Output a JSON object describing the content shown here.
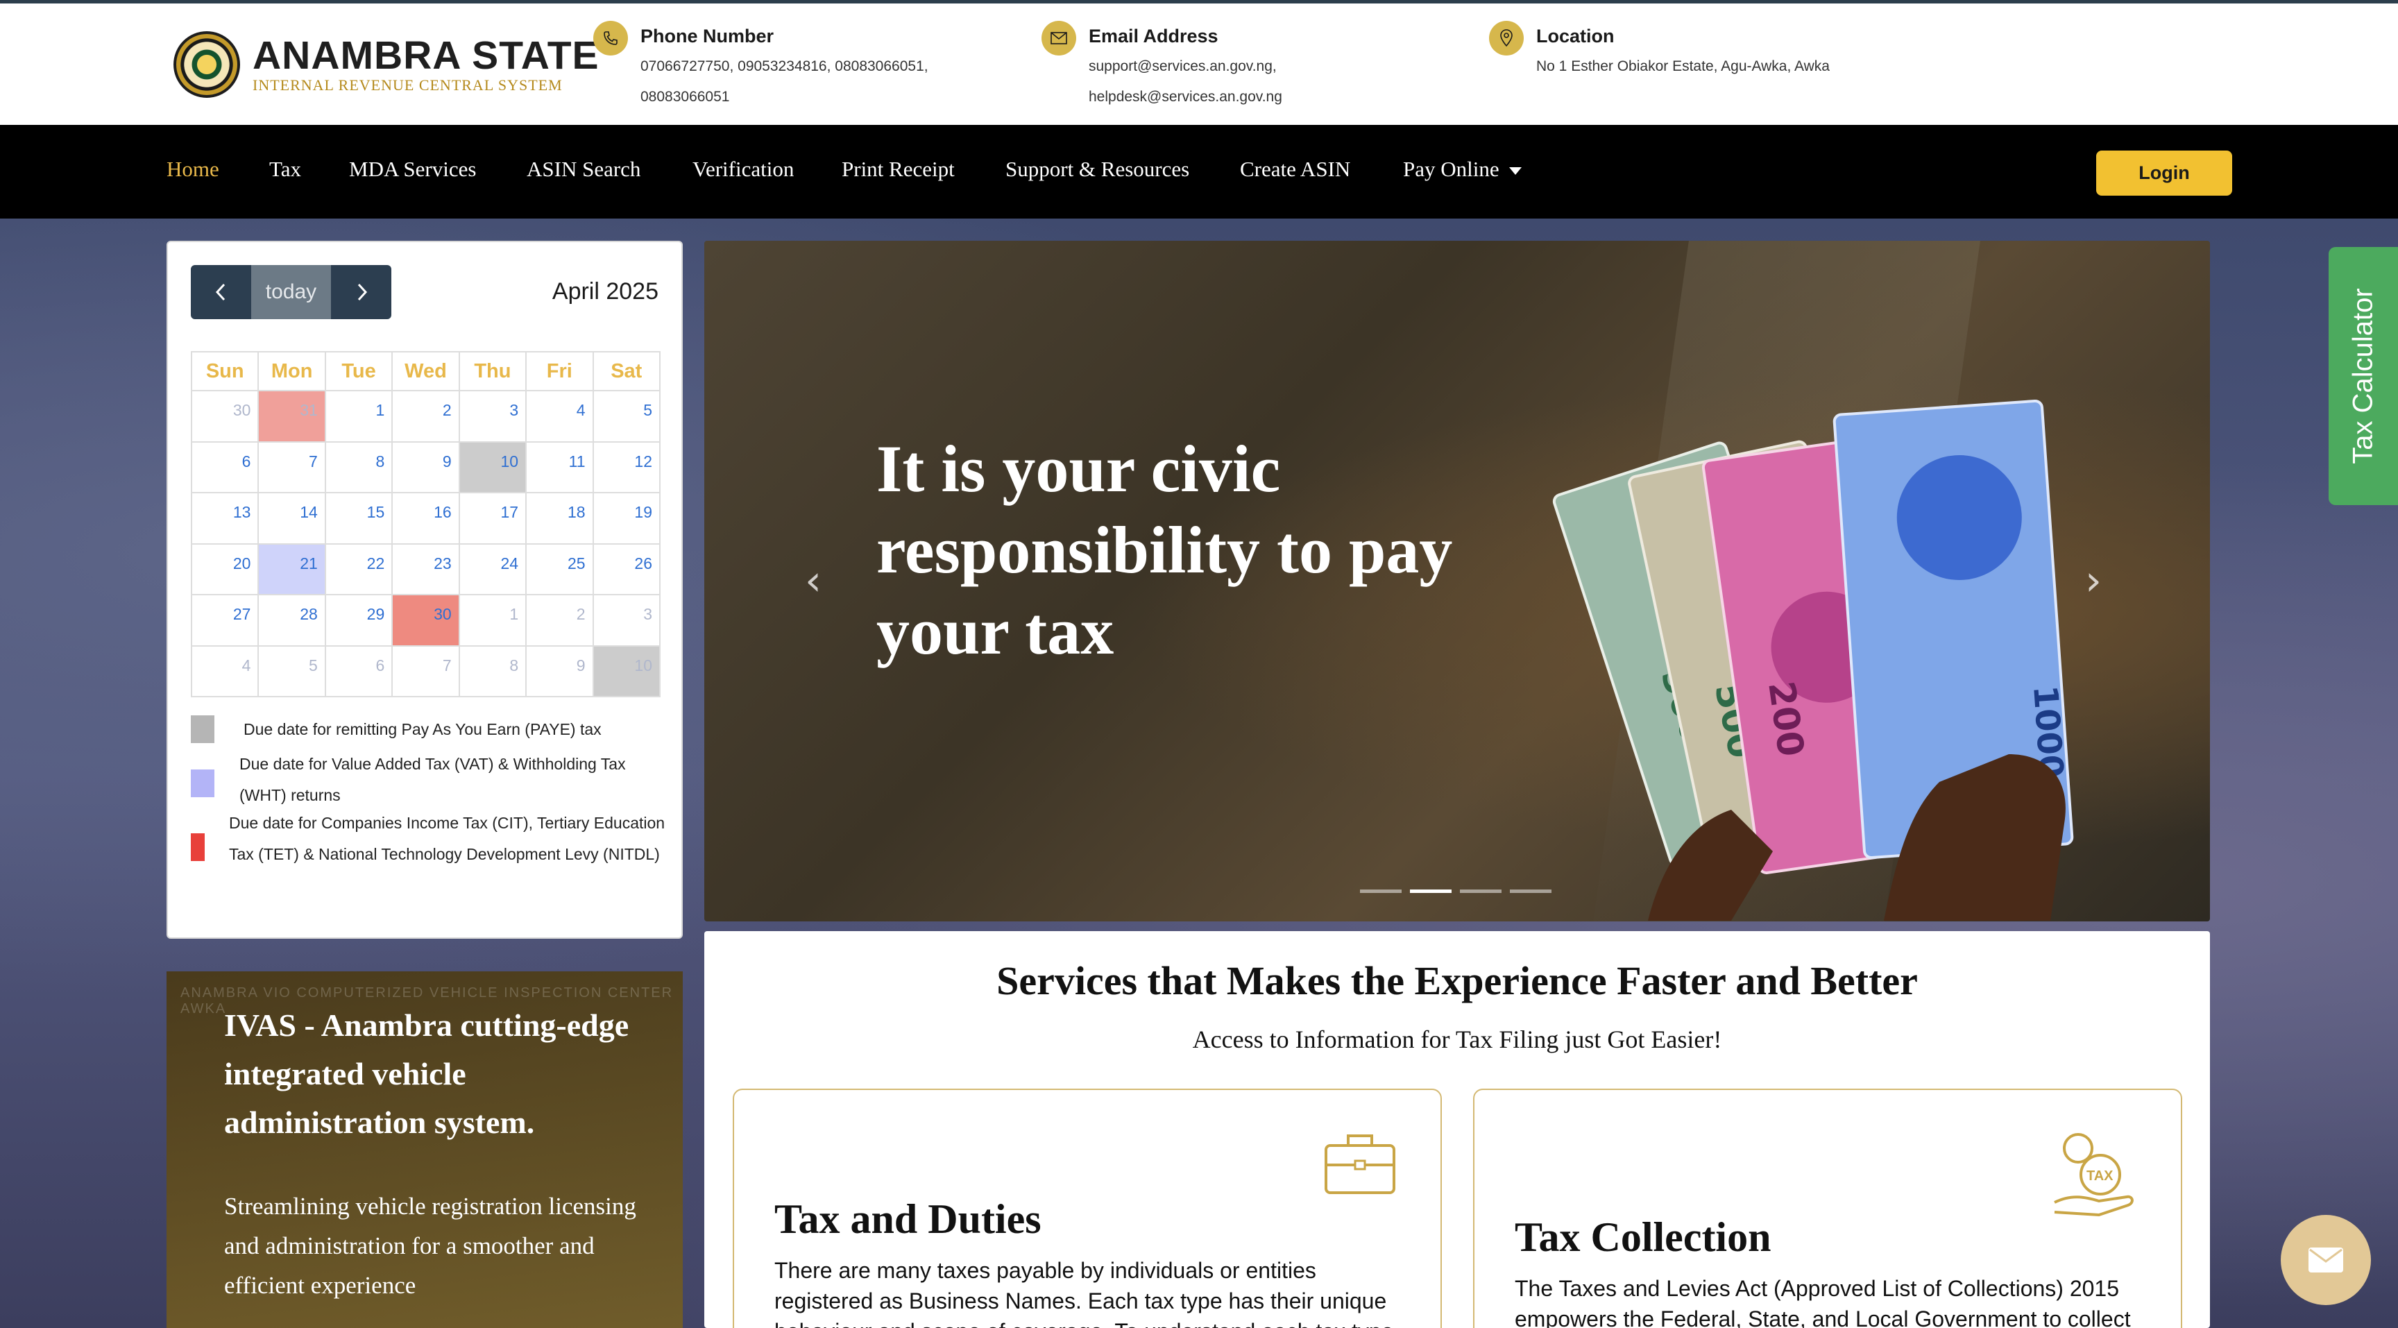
{
  "header": {
    "logo_title": "ANAMBRA STATE",
    "logo_subtitle": "INTERNAL REVENUE CENTRAL SYSTEM",
    "phone": {
      "label": "Phone Number",
      "line1": "07066727750, 09053234816, 08083066051,",
      "line2": "08083066051"
    },
    "email": {
      "label": "Email Address",
      "line1": "support@services.an.gov.ng,",
      "line2": "helpdesk@services.an.gov.ng"
    },
    "location": {
      "label": "Location",
      "line1": "No 1 Esther Obiakor Estate, Agu-Awka, Awka"
    }
  },
  "nav": {
    "items": [
      "Home",
      "Tax",
      "MDA Services",
      "ASIN Search",
      "Verification",
      "Print Receipt",
      "Support & Resources",
      "Create ASIN",
      "Pay Online"
    ],
    "active": "Home",
    "login_label": "Login"
  },
  "calendar": {
    "today_label": "today",
    "month": "April 2025",
    "weekdays": [
      "Sun",
      "Mon",
      "Tue",
      "Wed",
      "Thu",
      "Fri",
      "Sat"
    ],
    "weeks": [
      [
        "30",
        "31",
        "1",
        "2",
        "3",
        "4",
        "5"
      ],
      [
        "6",
        "7",
        "8",
        "9",
        "10",
        "11",
        "12"
      ],
      [
        "13",
        "14",
        "15",
        "16",
        "17",
        "18",
        "19"
      ],
      [
        "20",
        "21",
        "22",
        "23",
        "24",
        "25",
        "26"
      ],
      [
        "27",
        "28",
        "29",
        "30",
        "1",
        "2",
        "3"
      ],
      [
        "4",
        "5",
        "6",
        "7",
        "8",
        "9",
        "10"
      ]
    ],
    "legend": [
      {
        "color": "#b5b5b5",
        "text": "Due date for remitting Pay As You Earn (PAYE) tax"
      },
      {
        "color": "#b3b4f7",
        "text": "Due date for Value Added Tax (VAT) & Withholding Tax (WHT) returns"
      },
      {
        "color": "#e8403a",
        "text": "Due date for Companies Income Tax (CIT), Tertiary Education Tax (TET) & National Technology Development Levy (NITDL)"
      }
    ]
  },
  "hero": {
    "title": "It is your civic responsibility to pay your tax",
    "slides": 4,
    "active_slide": 2
  },
  "side_tab": {
    "label": "Tax Calculator"
  },
  "ivas": {
    "bg_text": "ANAMBRA VIO COMPUTERIZED VEHICLE INSPECTION CENTER AWKA",
    "title": "IVAS - Anambra cutting-edge integrated vehicle administration system.",
    "description": "Streamlining vehicle registration licensing and administration for a smoother and efficient experience"
  },
  "services": {
    "title": "Services that Makes the Experience Faster and Better",
    "subtitle": "Access to Information for Tax Filing just Got Easier!",
    "cards": [
      {
        "title": "Tax and Duties",
        "icon": "briefcase-icon",
        "desc_line1": "There are many taxes payable by individuals or entities",
        "desc_line2": "registered as Business Names. Each tax type has their unique",
        "desc_line3": "behaviour and scope of coverage. To understand each tax type"
      },
      {
        "title": "Tax Collection",
        "icon": "tax-hand-coin-icon",
        "desc_line1": "The Taxes and Levies Act (Approved List of Collections) 2015",
        "desc_line2": "empowers the Federal, State, and Local Government to collect"
      }
    ]
  },
  "colors": {
    "accent": "#e8b84a",
    "nav_bg": "#000000",
    "login": "#f2c131",
    "side_tab": "#4caa5e"
  }
}
